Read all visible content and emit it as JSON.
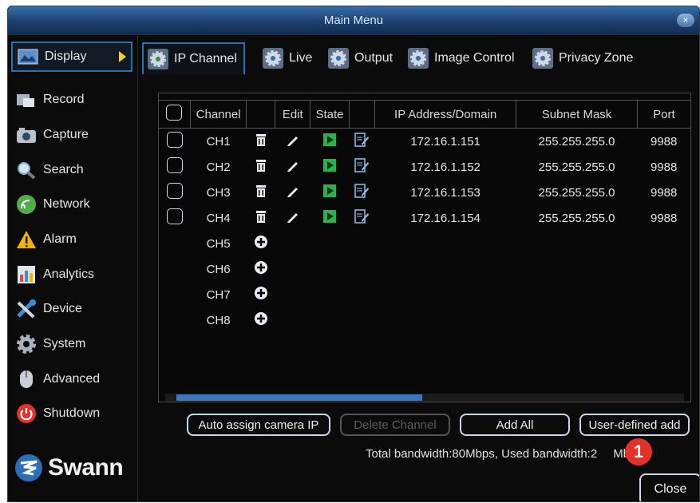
{
  "window": {
    "title": "Main Menu",
    "close_glyph": "×"
  },
  "sidebar": {
    "items": [
      {
        "label": "Display",
        "icon": "display-icon",
        "active": true
      },
      {
        "label": "Record",
        "icon": "record-icon"
      },
      {
        "label": "Capture",
        "icon": "camera-icon"
      },
      {
        "label": "Search",
        "icon": "search-icon"
      },
      {
        "label": "Network",
        "icon": "network-icon"
      },
      {
        "label": "Alarm",
        "icon": "alarm-warning-icon"
      },
      {
        "label": "Analytics",
        "icon": "analytics-icon"
      },
      {
        "label": "Device",
        "icon": "device-tools-icon"
      },
      {
        "label": "System",
        "icon": "gear-icon"
      },
      {
        "label": "Advanced",
        "icon": "advanced-mouse-icon"
      },
      {
        "label": "Shutdown",
        "icon": "power-icon"
      }
    ],
    "logo_text": "Swann"
  },
  "tabs": [
    {
      "label": "IP Channel",
      "active": true
    },
    {
      "label": "Live"
    },
    {
      "label": "Output"
    },
    {
      "label": "Image Control"
    },
    {
      "label": "Privacy Zone"
    }
  ],
  "table": {
    "headers": [
      "Channel",
      "Edit",
      "State",
      "IP Address/Domain",
      "Subnet Mask",
      "Port"
    ],
    "rows": [
      {
        "channel": "CH1",
        "ip": "172.16.1.151",
        "mask": "255.255.255.0",
        "port": "9988",
        "configured": true
      },
      {
        "channel": "CH2",
        "ip": "172.16.1.152",
        "mask": "255.255.255.0",
        "port": "9988",
        "configured": true
      },
      {
        "channel": "CH3",
        "ip": "172.16.1.153",
        "mask": "255.255.255.0",
        "port": "9988",
        "configured": true
      },
      {
        "channel": "CH4",
        "ip": "172.16.1.154",
        "mask": "255.255.255.0",
        "port": "9988",
        "configured": true
      },
      {
        "channel": "CH5",
        "configured": false
      },
      {
        "channel": "CH6",
        "configured": false
      },
      {
        "channel": "CH7",
        "configured": false
      },
      {
        "channel": "CH8",
        "configured": false
      }
    ]
  },
  "buttons": {
    "auto_assign": "Auto assign camera IP",
    "delete_channel": "Delete Channel",
    "add_all": "Add All",
    "user_defined": "User-defined add",
    "close": "Close"
  },
  "status": {
    "bandwidth_prefix": "Total bandwidth:80Mbps, Used bandwidth:2",
    "bandwidth_suffix": "Mbps"
  },
  "annotation": {
    "marker": "1"
  },
  "colors": {
    "accent": "#2f6fb0",
    "title_bar": "#1b3f6e",
    "state_play": "#2bb24c",
    "marker": "#e4312b",
    "scroll_thumb": "#3d78bf"
  }
}
